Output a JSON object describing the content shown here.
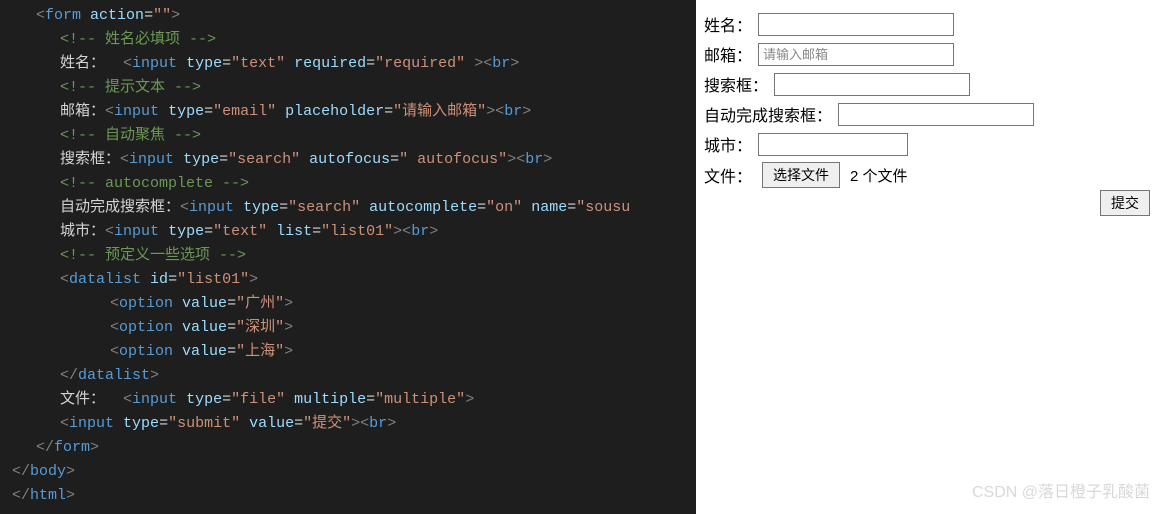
{
  "code": {
    "form_open": "form",
    "action_attr": "action",
    "action_val": "\"\"",
    "c_name_req": "<!-- 姓名必填项 -->",
    "lbl_name": "姓名：",
    "input": "input",
    "type": "type",
    "t_text": "\"text\"",
    "required": "required",
    "r_val": "\"required\"",
    "br": "br",
    "c_hint": "<!-- 提示文本 -->",
    "lbl_email": "邮箱：",
    "t_email": "\"email\"",
    "placeholder": "placeholder",
    "ph_val": "\"请输入邮箱\"",
    "c_autofocus": "<!-- 自动聚焦 -->",
    "lbl_search": "搜索框：",
    "t_search": "\"search\"",
    "autofocus": "autofocus",
    "af_val": "\" autofocus\"",
    "c_autocomplete": "<!-- autocomplete -->",
    "lbl_autosearch": "自动完成搜索框：",
    "autocomplete": "autocomplete",
    "ac_val": "\"on\"",
    "name": "name",
    "name_val": "\"sousu",
    "lbl_city": "城市：",
    "list": "list",
    "list_val": "\"list01\"",
    "c_predef": "<!-- 预定义一些选项 -->",
    "datalist": "datalist",
    "id": "id",
    "option": "option",
    "value": "value",
    "opt1": "\"广州\"",
    "opt2": "\"深圳\"",
    "opt3": "\"上海\"",
    "lbl_file": "文件：",
    "t_file": "\"file\"",
    "multiple": "multiple",
    "m_val": "\"multiple\"",
    "t_submit": "\"submit\"",
    "submit_val": "\"提交\"",
    "form_close": "form",
    "body": "body",
    "html": "html"
  },
  "form": {
    "lbl_name": "姓名：",
    "lbl_email": "邮箱：",
    "email_ph": "请输入邮箱",
    "lbl_search": "搜索框：",
    "lbl_autosearch": "自动完成搜索框：",
    "lbl_city": "城市：",
    "lbl_file": "文件：",
    "file_btn": "选择文件",
    "file_status": "2 个文件",
    "submit": "提交"
  },
  "watermark": "CSDN @落日橙子乳酸菌"
}
